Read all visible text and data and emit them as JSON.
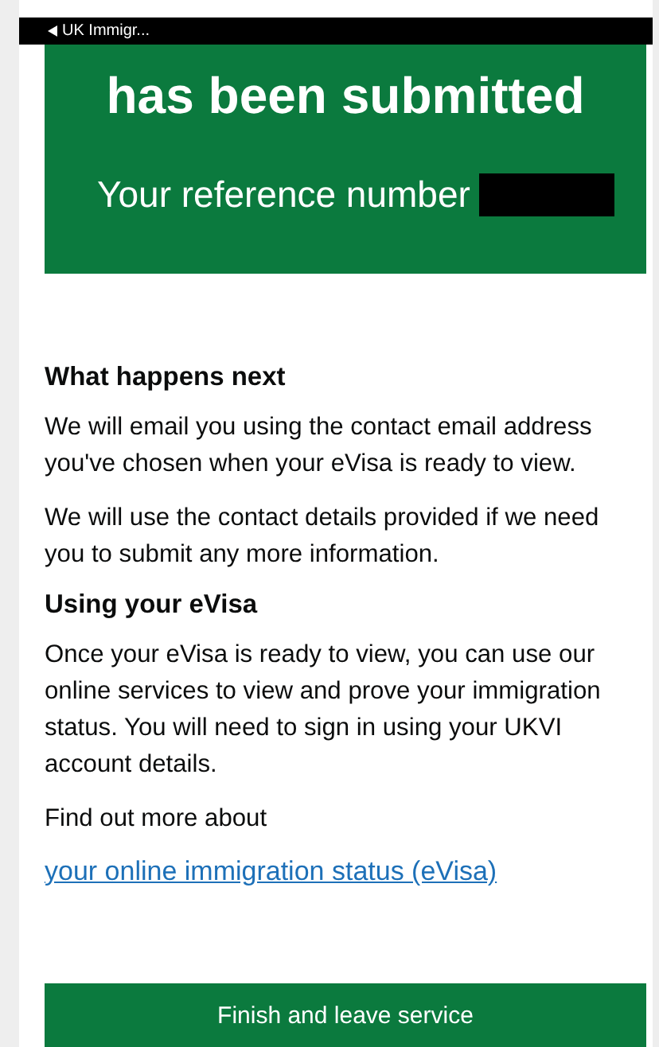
{
  "status_bar": {
    "back_label": "UK Immigr..."
  },
  "panel": {
    "title": "has been submitted",
    "reference_label": "Your reference number"
  },
  "sections": [
    {
      "heading": "What happens next",
      "paragraphs": [
        "We will email you using the contact email address you've chosen when your eVisa is ready to view.",
        "We will use the contact details provided if we need you to submit any more information."
      ]
    },
    {
      "heading": "Using your eVisa",
      "paragraphs": [
        "Once your eVisa is ready to view, you can use our online services to view and prove your immigration status. You will need to sign in using your UKVI account details.",
        "Find out more about"
      ]
    }
  ],
  "link": "your online immigration status (eVisa)",
  "button": "Finish and leave service"
}
